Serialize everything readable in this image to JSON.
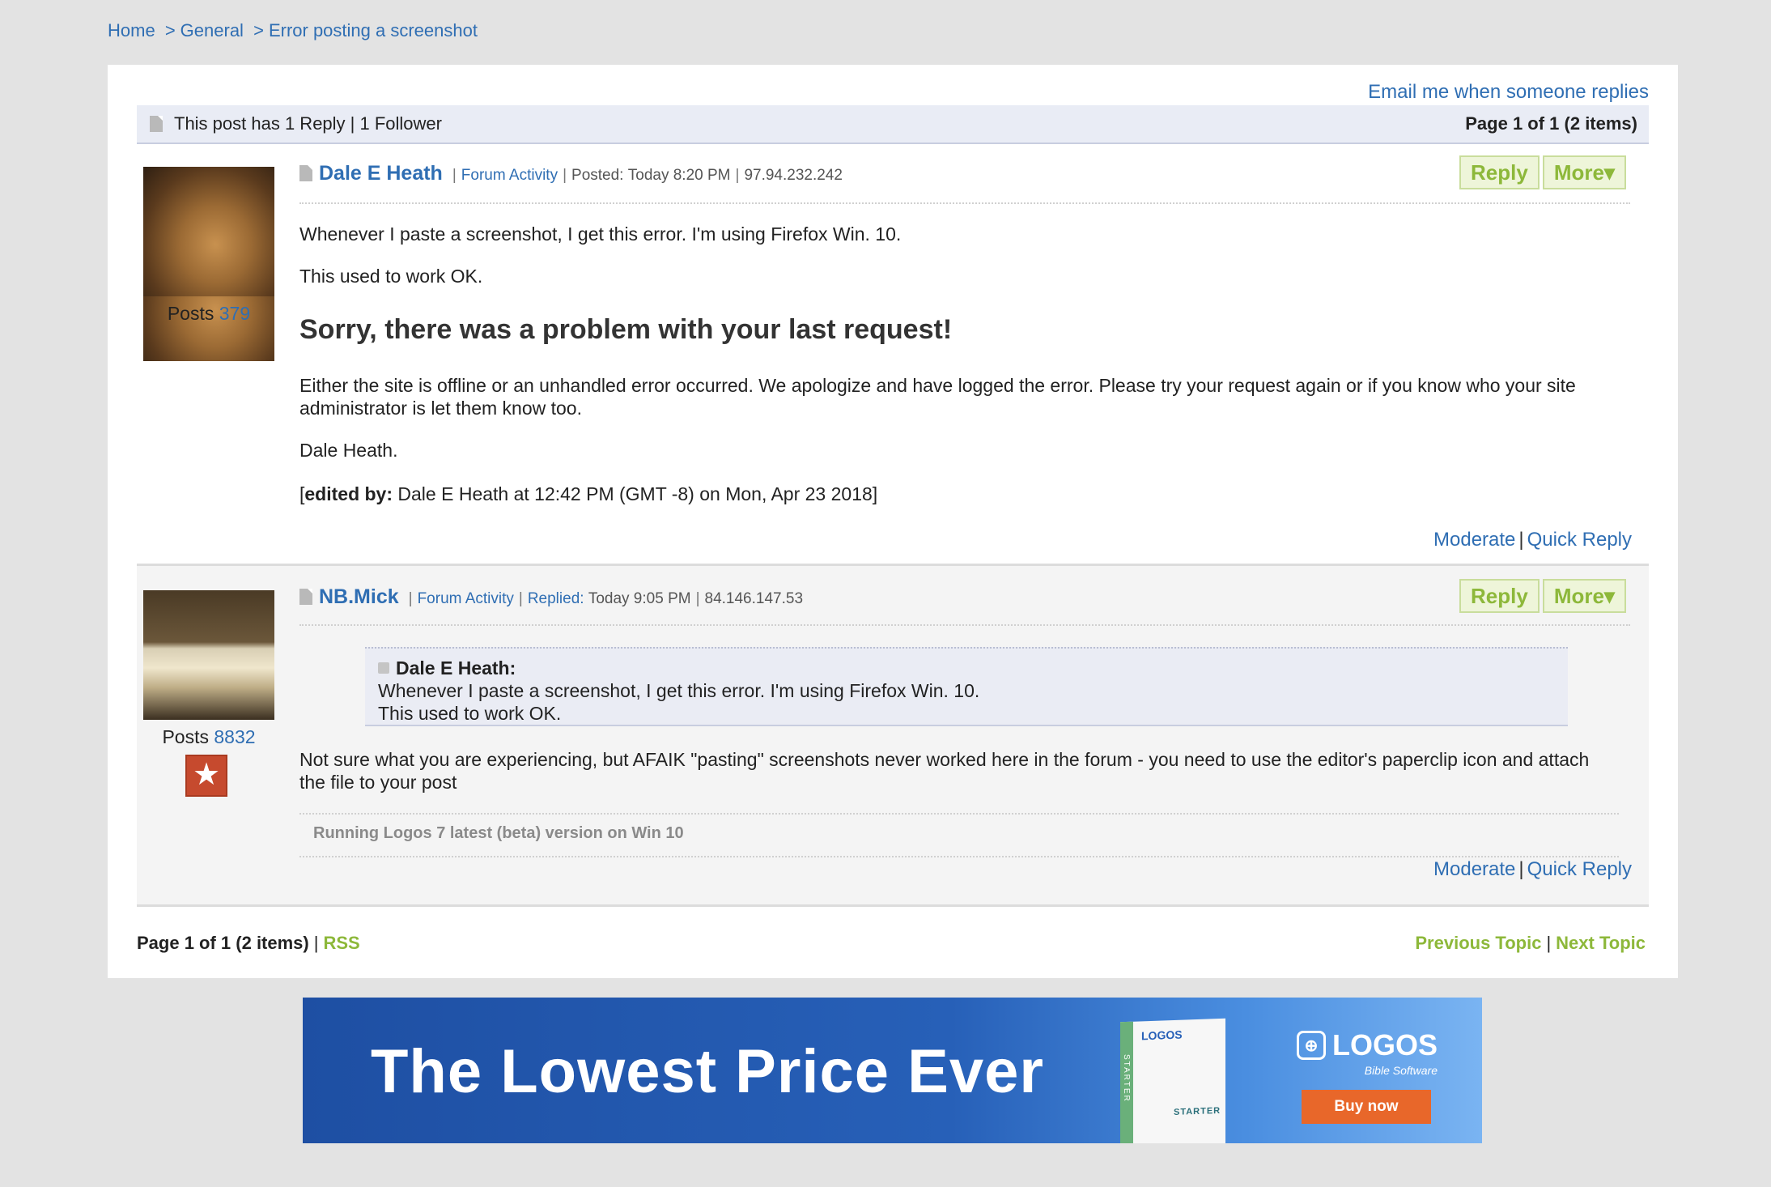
{
  "breadcrumb": {
    "home": "Home",
    "sep1": ">",
    "section": "General",
    "sep2": ">",
    "current": "Error posting a screenshot"
  },
  "thread": {
    "email_link": "Email me when someone replies",
    "summary": "This post has 1 Reply | 1 Follower",
    "page_info": "Page 1 of 1 (2 items)"
  },
  "posts": [
    {
      "author": "Dale E Heath",
      "forum_activity": "Forum Activity",
      "posted_label": "Posted:",
      "time": "Today 8:20 PM",
      "ip": "97.94.232.242",
      "posts_label": "Posts",
      "posts_count": "379",
      "reply_btn": "Reply",
      "more_btn": "More▾",
      "text1": "Whenever I paste a screenshot, I get this error. I'm using Firefox Win. 10.",
      "text2": "This used to work OK.",
      "error_title": "Sorry, there was a problem with your last request!",
      "error_body": "Either the site is offline or an unhandled error occurred. We apologize and have logged the error. Please try your request again or if you know who your site administrator is let them know too.",
      "signoff": "Dale Heath.",
      "edited_label": "edited by:",
      "edited_text": "Dale E Heath at 12:42 PM (GMT -8) on Mon, Apr 23 2018]",
      "edited_open": "[",
      "moderate": "Moderate",
      "quick_reply": "Quick Reply"
    },
    {
      "author": "NB.Mick",
      "forum_activity": "Forum Activity",
      "posted_label": "Replied:",
      "time": "Today 9:05 PM",
      "ip": "84.146.147.53",
      "posts_label": "Posts",
      "posts_count": "8832",
      "reply_btn": "Reply",
      "more_btn": "More▾",
      "quote_author": "Dale E Heath:",
      "quote_line1": "Whenever I paste a screenshot, I get this error. I'm using Firefox Win. 10.",
      "quote_line2": "This used to work OK.",
      "text1": "Not sure what you are experiencing, but AFAIK  \"pasting\" screenshots never worked here in the forum - you need to use the editor's paperclip icon and attach the file to your post",
      "signature": "Running Logos 7 latest (beta) version on Win 10",
      "moderate": "Moderate",
      "quick_reply": "Quick Reply"
    }
  ],
  "footer": {
    "page_info": "Page 1 of 1 (2 items)",
    "rss": "RSS",
    "prev_topic": "Previous Topic",
    "next_topic": "Next Topic"
  },
  "banner": {
    "headline": "The Lowest Price Ever",
    "box_logo": "LOGOS",
    "box_starter": "STARTER",
    "box_side": "STARTER",
    "brand": "LOGOS",
    "brand_sub": "Bible Software",
    "cta": "Buy now"
  },
  "colors": {
    "link": "#2f6eb3",
    "green": "#8db83a",
    "banner_blue": "#2760b8",
    "cta_orange": "#e8672a"
  }
}
